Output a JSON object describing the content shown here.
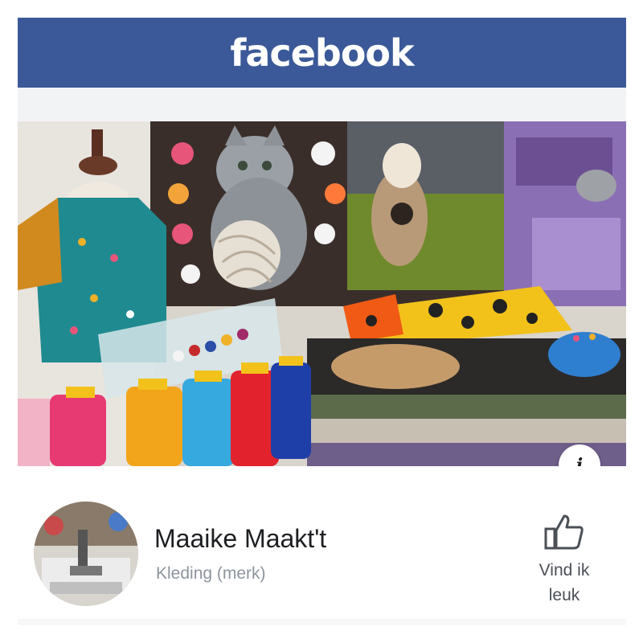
{
  "header": {
    "brand": "facebook",
    "brand_color": "#3b5998"
  },
  "cover": {
    "alt_subject": "sewing fabrics, thread spools, dress form with shirt",
    "info_button_label": "i"
  },
  "page": {
    "name": "Maaike Maakt't",
    "category": "Kleding (merk)",
    "like_label": "Vind ik leuk",
    "like_icon": "thumbs-up-icon",
    "avatar_icon": "sewing-machine-avatar"
  }
}
